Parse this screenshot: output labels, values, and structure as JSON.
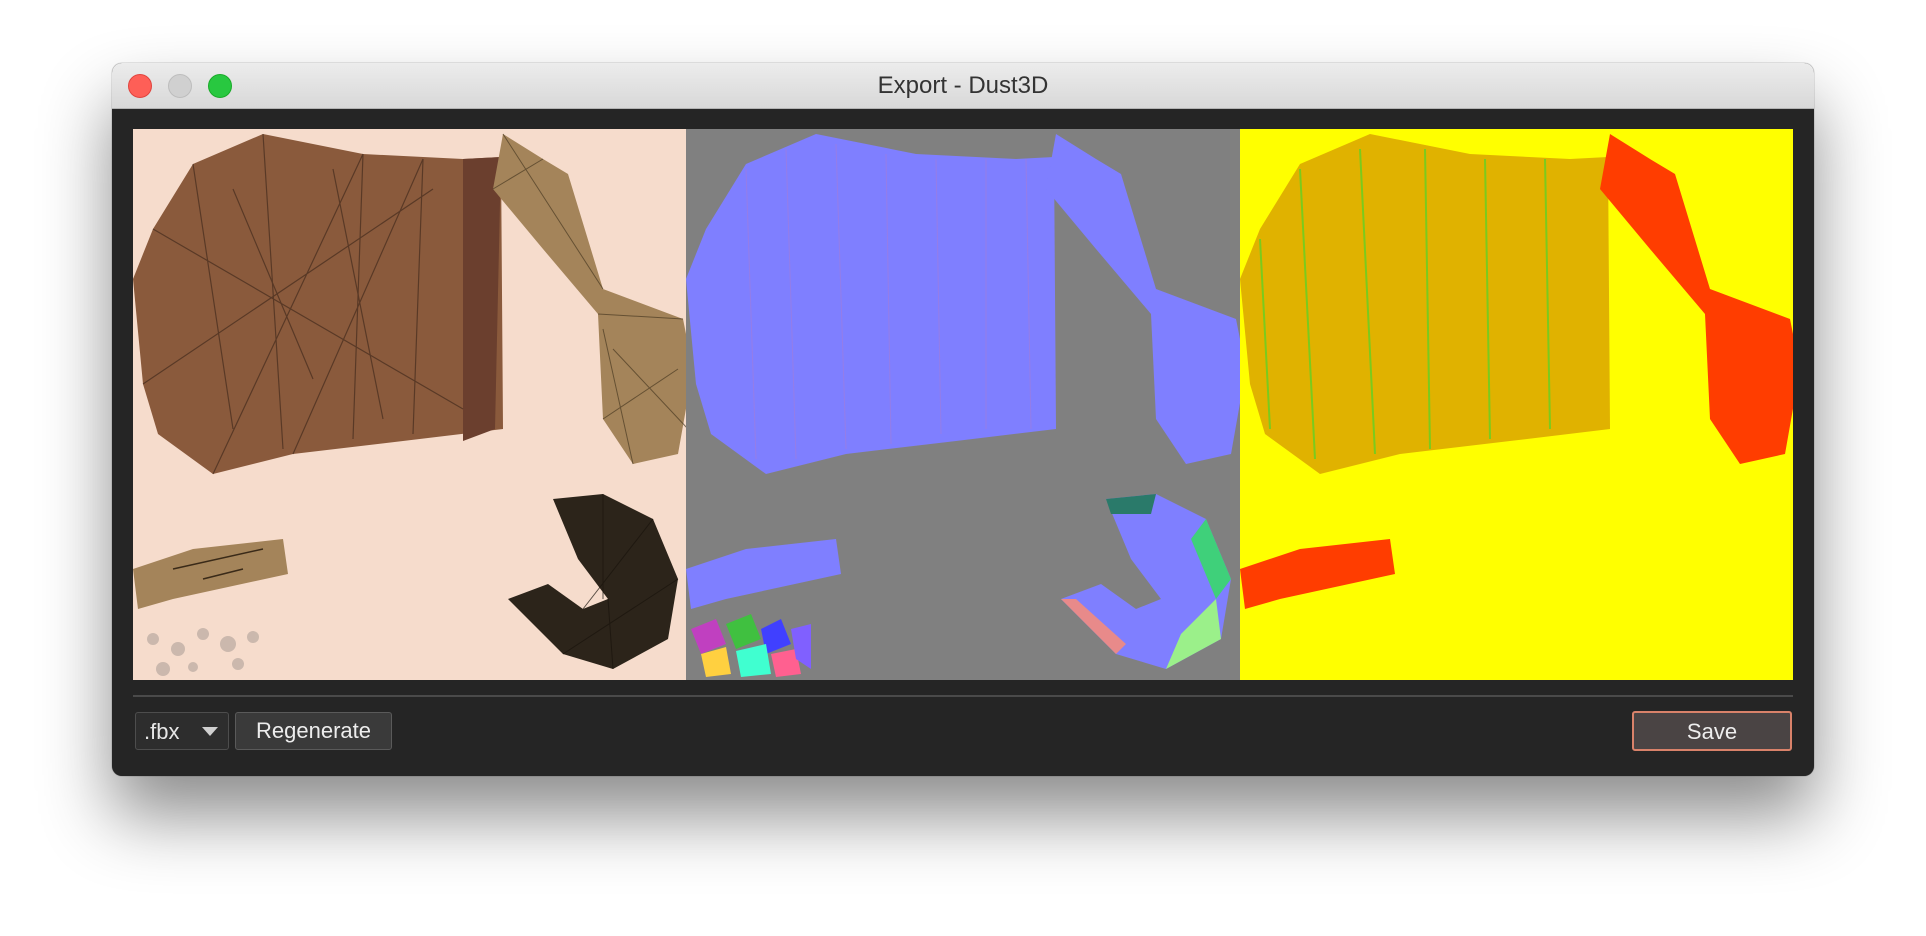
{
  "window": {
    "title": "Export - Dust3D",
    "controls": [
      "close",
      "minimize",
      "maximize"
    ]
  },
  "preview": {
    "panels": [
      "texture-color-map",
      "texture-normal-map",
      "texture-metalness-roughness-ao-map"
    ],
    "colors": {
      "color_background": "#f6dccc",
      "normal_background": "#808080",
      "material_background": "#ffff00",
      "wood": "#8a5a3c",
      "wood_light": "#a4845a",
      "wood_dark": "#2c241a",
      "normal_blue": "#7f7fff",
      "material_orange": "#e0b200",
      "material_red": "#ff3d00"
    }
  },
  "footer": {
    "format_selected": ".fbx",
    "regenerate_label": "Regenerate",
    "save_label": "Save"
  }
}
